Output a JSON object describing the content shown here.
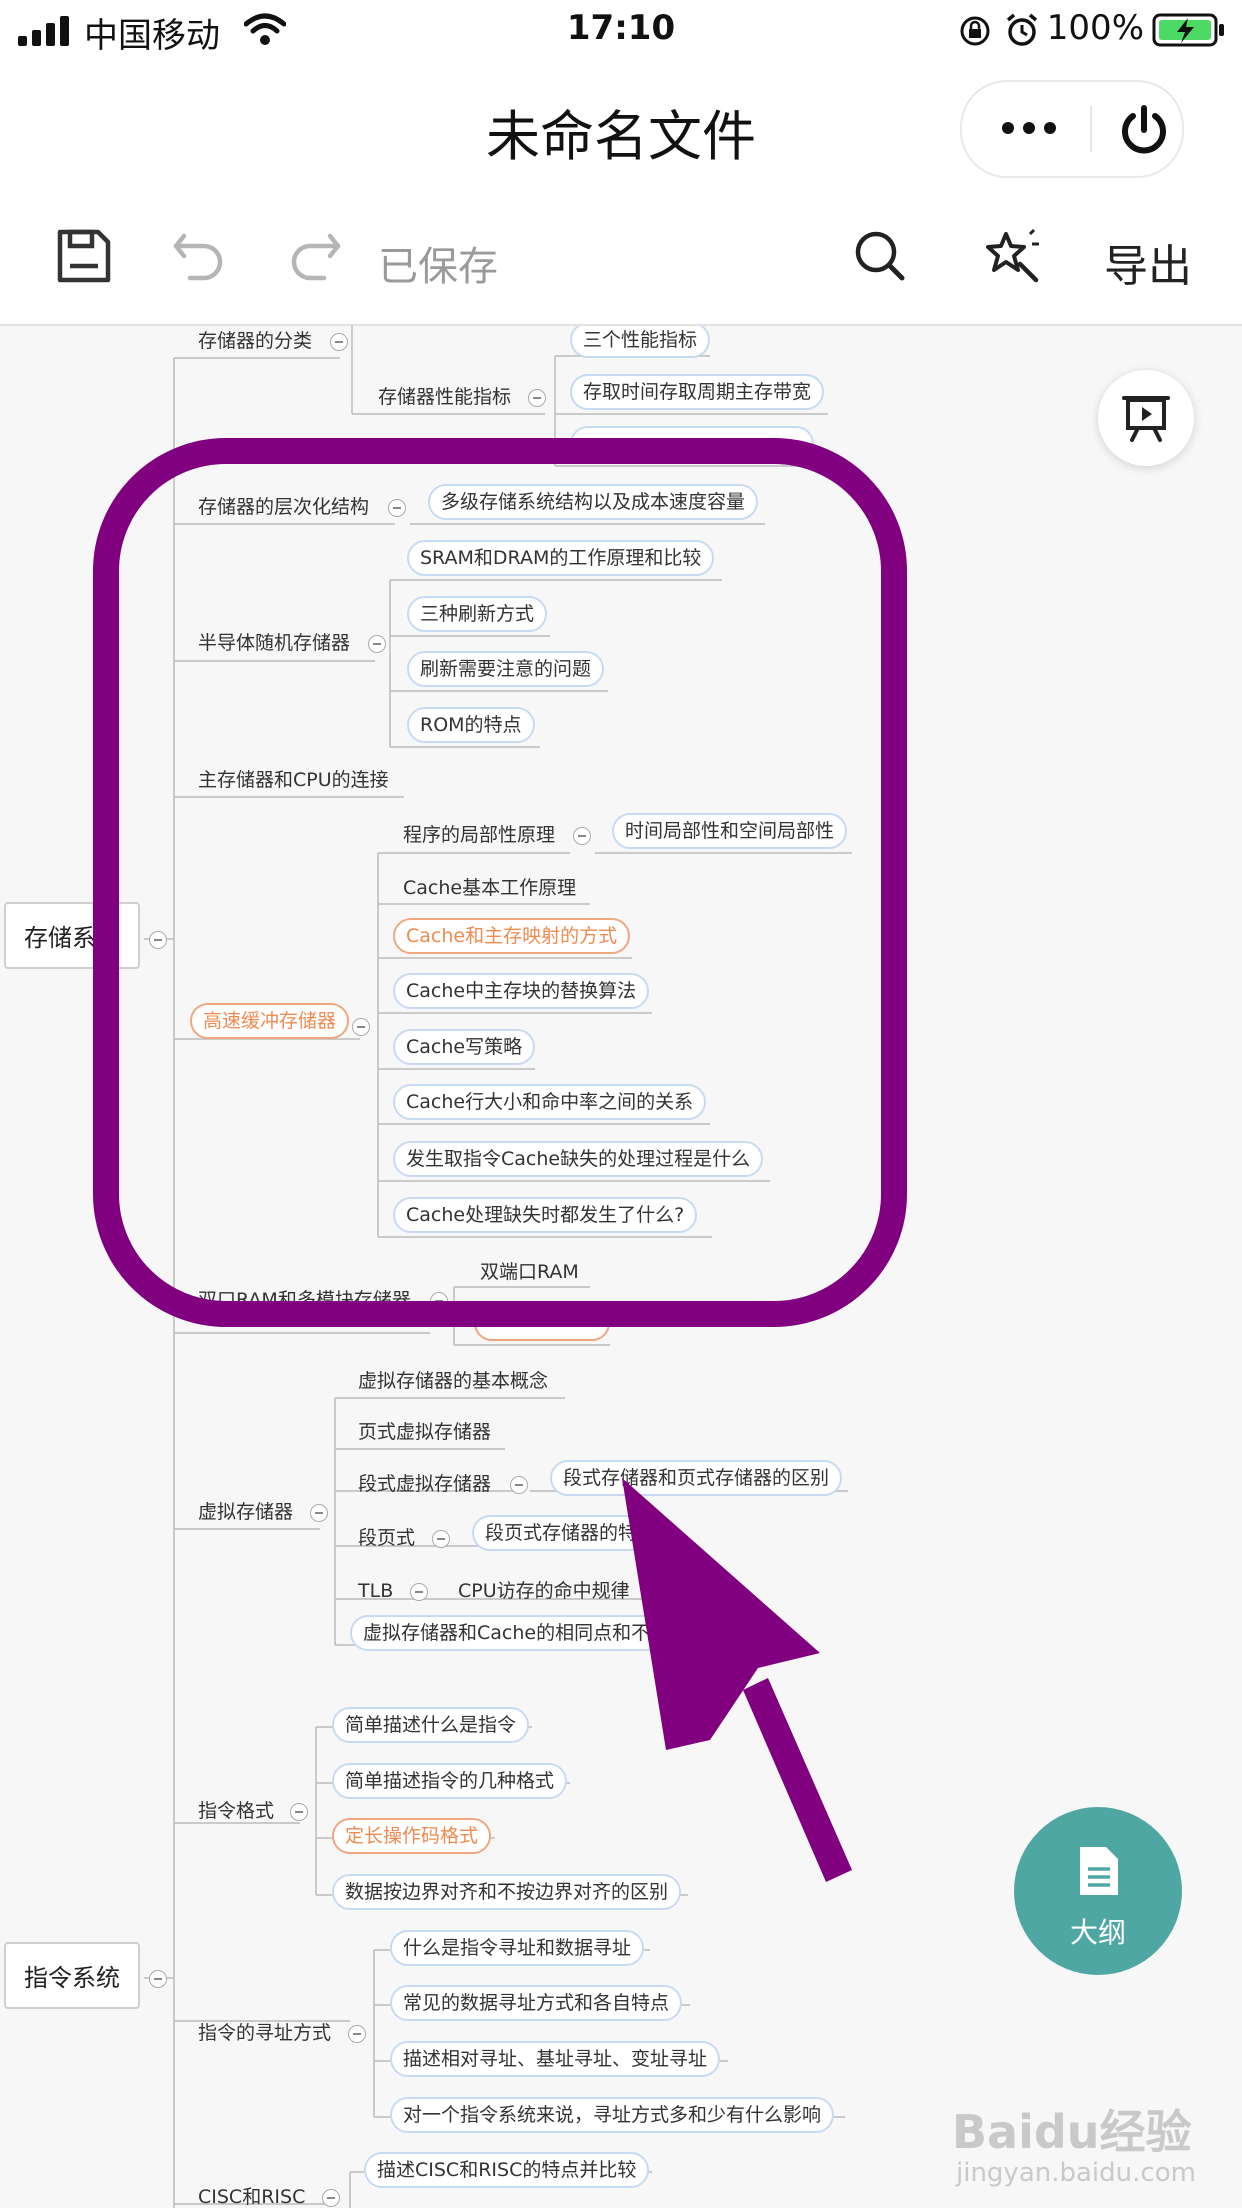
{
  "status_bar": {
    "carrier": "中国移动",
    "time": "17:10",
    "battery": "100%"
  },
  "nav": {
    "title": "未命名文件"
  },
  "toolbar": {
    "saved": "已保存",
    "export": "导出"
  },
  "mindmap": {
    "root1": "存储系统",
    "root2": "指令系统",
    "nodes": {
      "classify": "存储器的分类",
      "perf": "存储器性能指标",
      "perf_c1": "三个性能指标",
      "perf_c2": "存取时间存取周期主存带宽",
      "hier": "存储器的层次化结构",
      "hier_c1": "多级存储系统结构以及成本速度容量",
      "semi": "半导体随机存储器",
      "semi_c1": "SRAM和DRAM的工作原理和比较",
      "semi_c2": "三种刷新方式",
      "semi_c3": "刷新需要注意的问题",
      "semi_c4": "ROM的特点",
      "conn": "主存储器和CPU的连接",
      "cache": "高速缓冲存储器",
      "local": "程序的局部性原理",
      "local_c1": "时间局部性和空间局部性",
      "cache_c1": "Cache基本工作原理",
      "cache_c2": "Cache和主存映射的方式",
      "cache_c3": "Cache中主存块的替换算法",
      "cache_c4": "Cache写策略",
      "cache_c5": "Cache行大小和命中率之间的关系",
      "cache_c6": "发生取指令Cache缺失的处理过程是什么",
      "cache_c7": "Cache处理缺失时都发生了什么?",
      "dual": "双口RAM和多模块存储器",
      "dual_c1": "双端口RAM",
      "virt": "虚拟存储器",
      "virt_c1": "虚拟存储器的基本概念",
      "virt_c2": "页式虚拟存储器",
      "virt_c3": "段式虚拟存储器",
      "virt_c3_c1": "段式存储器和页式存储器的区别",
      "virt_c4": "段页式",
      "virt_c4_c1": "段页式存储器的特",
      "virt_c5": "TLB",
      "virt_c5_c1": "CPU访存的命中规律",
      "virt_c6": "虚拟存储器和Cache的相同点和不",
      "fmt": "指令格式",
      "fmt_c1": "简单描述什么是指令",
      "fmt_c2": "简单描述指令的几种格式",
      "fmt_c3": "定长操作码格式",
      "fmt_c4": "数据按边界对齐和不按边界对齐的区别",
      "addr": "指令的寻址方式",
      "addr_c1": "什么是指令寻址和数据寻址",
      "addr_c2": "常见的数据寻址方式和各自特点",
      "addr_c3": "描述相对寻址、基址寻址、变址寻址",
      "addr_c4": "对一个指令系统来说，寻址方式多和少有什么影响",
      "cisc": "CISC和RISC",
      "cisc_c1": "描述CISC和RISC的特点并比较"
    }
  },
  "outline_button": {
    "label": "大纲"
  },
  "watermark": {
    "text": "Baidu经验",
    "url": "jingyan.baidu.com"
  },
  "colors": {
    "accent_orange": "#ef8a50",
    "annotation_purple": "#800080",
    "outline_teal": "#4fa7a4",
    "pill_border": "#c8daf3"
  }
}
